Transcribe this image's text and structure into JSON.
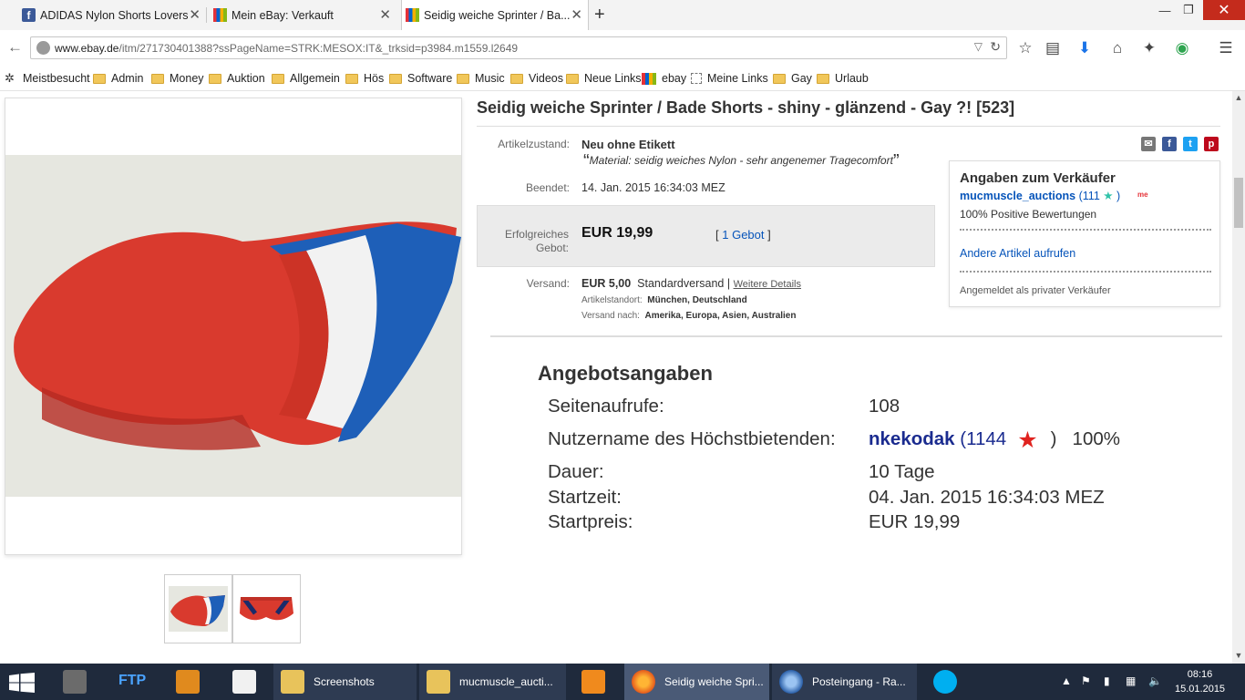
{
  "browser": {
    "tabs": [
      {
        "label": "ADIDAS Nylon Shorts Lovers"
      },
      {
        "label": "Mein eBay: Verkauft"
      },
      {
        "label": "Seidig weiche Sprinter / Ba..."
      }
    ],
    "url_domain": "www.ebay.de",
    "url_path": "/itm/271730401388?ssPageName=STRK:MESOX:IT&_trksid=p3984.m1559.l2649"
  },
  "bookmarks": [
    "Meistbesucht",
    "Admin",
    "Money",
    "Auktion",
    "Allgemein",
    "Hös",
    "Software",
    "Music",
    "Videos",
    "Neue Links",
    "ebay",
    "Meine Links",
    "Gay",
    "Urlaub"
  ],
  "listing": {
    "title": "Seidig weiche Sprinter / Bade Shorts - shiny - glänzend - Gay ?! [523]",
    "condition_label": "Artikelzustand:",
    "condition_value": "Neu ohne Etikett",
    "quote": "Material: seidig weiches Nylon - sehr angenemer Tragecomfort",
    "ended_label": "Beendet:",
    "ended_value": "14. Jan. 2015   16:34:03 MEZ",
    "result_label": "Erfolgreiches Gebot:",
    "price": "EUR 19,99",
    "bids": "1 Gebot",
    "shipping_label": "Versand:",
    "shipping_price": "EUR 5,00",
    "shipping_method": "Standardversand |",
    "shipping_details_link": "Weitere Details",
    "location_label": "Artikelstandort:",
    "location_value": "München, Deutschland",
    "ships_to_label": "Versand nach:",
    "ships_to_value": "Amerika, Europa, Asien, Australien"
  },
  "seller": {
    "heading": "Angaben zum Verkäufer",
    "name": "mucmuscle_auctions",
    "score": "(111",
    "score_end": ")",
    "me_badge": "me",
    "feedback": "100% Positive Bewertungen",
    "other_items_link": "Andere Artikel aufrufen",
    "note": "Angemeldet als privater Verkäufer"
  },
  "offer_details": {
    "heading": "Angebotsangaben",
    "rows": [
      {
        "label": "Seitenaufrufe:",
        "value": "108"
      },
      {
        "label": "Nutzername des Höchstbietenden:",
        "value": ""
      },
      {
        "label": "Dauer:",
        "value": "10 Tage"
      },
      {
        "label": "Startzeit:",
        "value": "04. Jan. 2015 16:34:03 MEZ"
      },
      {
        "label": "Startpreis:",
        "value": "EUR 19,99"
      }
    ],
    "bidder_name": "nkekodak",
    "bidder_score": "(1144",
    "bidder_score_end": ")",
    "bidder_percent": "100%"
  },
  "taskbar": {
    "tasks": [
      "Screenshots",
      "mucmuscle_aucti...",
      "Seidig weiche Spri...",
      "Posteingang - Ra..."
    ],
    "ftp_label": "FTP",
    "time": "08:16",
    "date": "15.01.2015"
  },
  "colors": {
    "link": "#0654ba",
    "bidder": "#1a2b8f",
    "seller_star": "#31c3a9",
    "close": "#c42b1c"
  }
}
